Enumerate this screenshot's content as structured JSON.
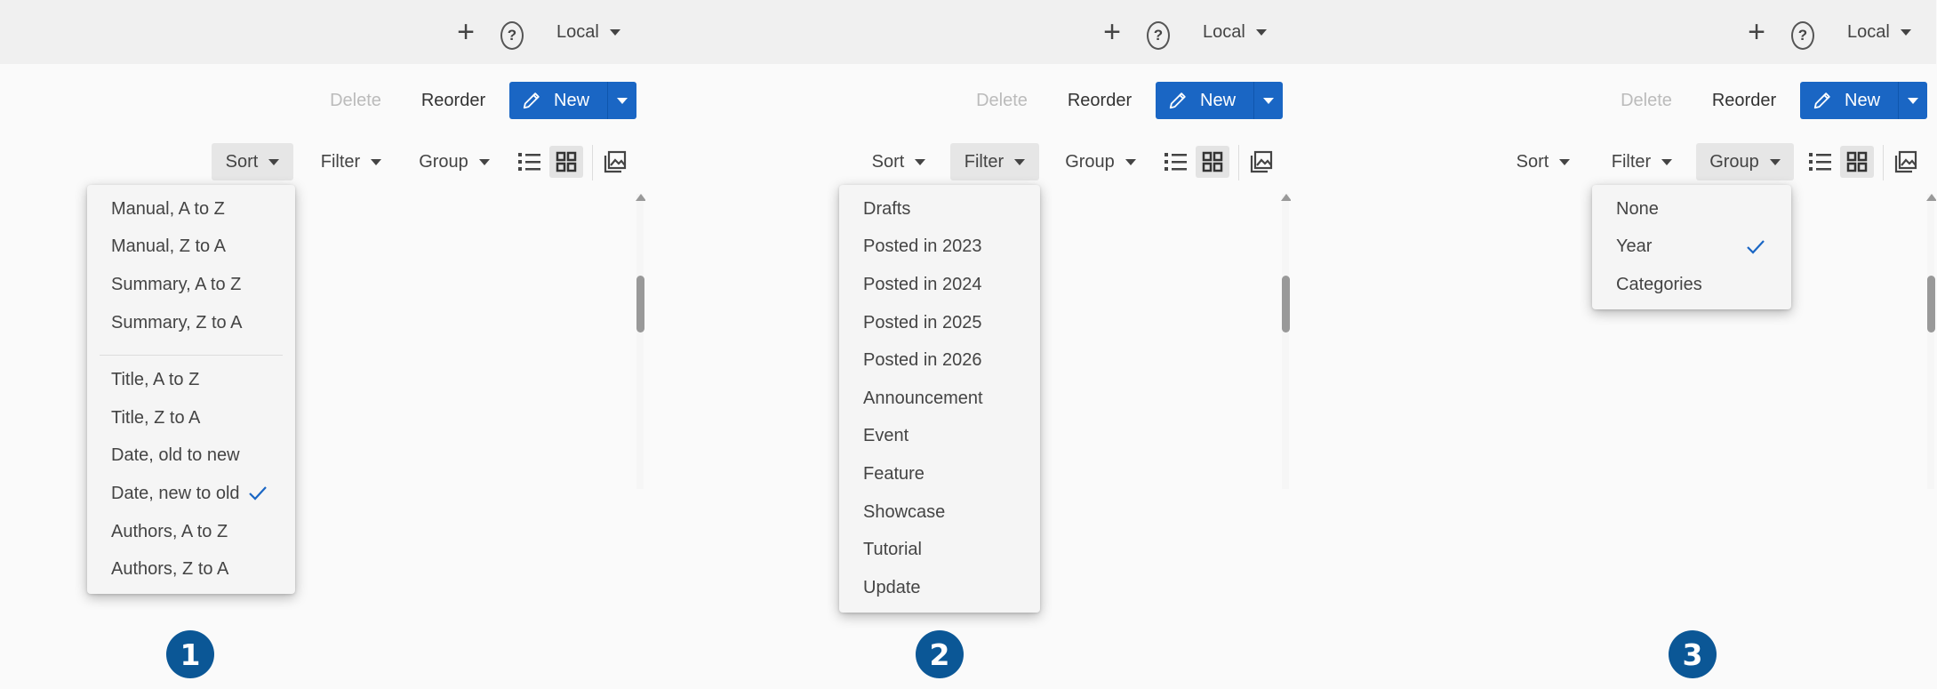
{
  "colors": {
    "accent": "#1a66c4",
    "badge": "#0b5796",
    "check": "#1a66c4"
  },
  "topbar": {
    "plus_icon": "plus-icon",
    "help_icon": "help-icon",
    "locale_label": "Local"
  },
  "actions": {
    "delete_label": "Delete",
    "reorder_label": "Reorder",
    "new_label": "New"
  },
  "viewbar": {
    "sort_label": "Sort",
    "filter_label": "Filter",
    "group_label": "Group"
  },
  "panels": [
    {
      "badge": "1",
      "open_menu": "sort",
      "menu_items": [
        "Manual, A to Z",
        "Manual, Z to A",
        "Summary, A to Z",
        "Summary, Z to A",
        "Title, A to Z",
        "Title, Z to A",
        "Date, old to new",
        "Date, new to old",
        "Authors, A to Z",
        "Authors, Z to A"
      ],
      "selected": "Date, new to old"
    },
    {
      "badge": "2",
      "open_menu": "filter",
      "menu_items": [
        "Drafts",
        "Posted in 2023",
        "Posted in 2024",
        "Posted in 2025",
        "Posted in 2026",
        "Announcement",
        "Event",
        "Feature",
        "Showcase",
        "Tutorial",
        "Update"
      ]
    },
    {
      "badge": "3",
      "open_menu": "group",
      "menu_items": [
        "None",
        "Year",
        "Categories"
      ],
      "selected": "Year"
    }
  ]
}
